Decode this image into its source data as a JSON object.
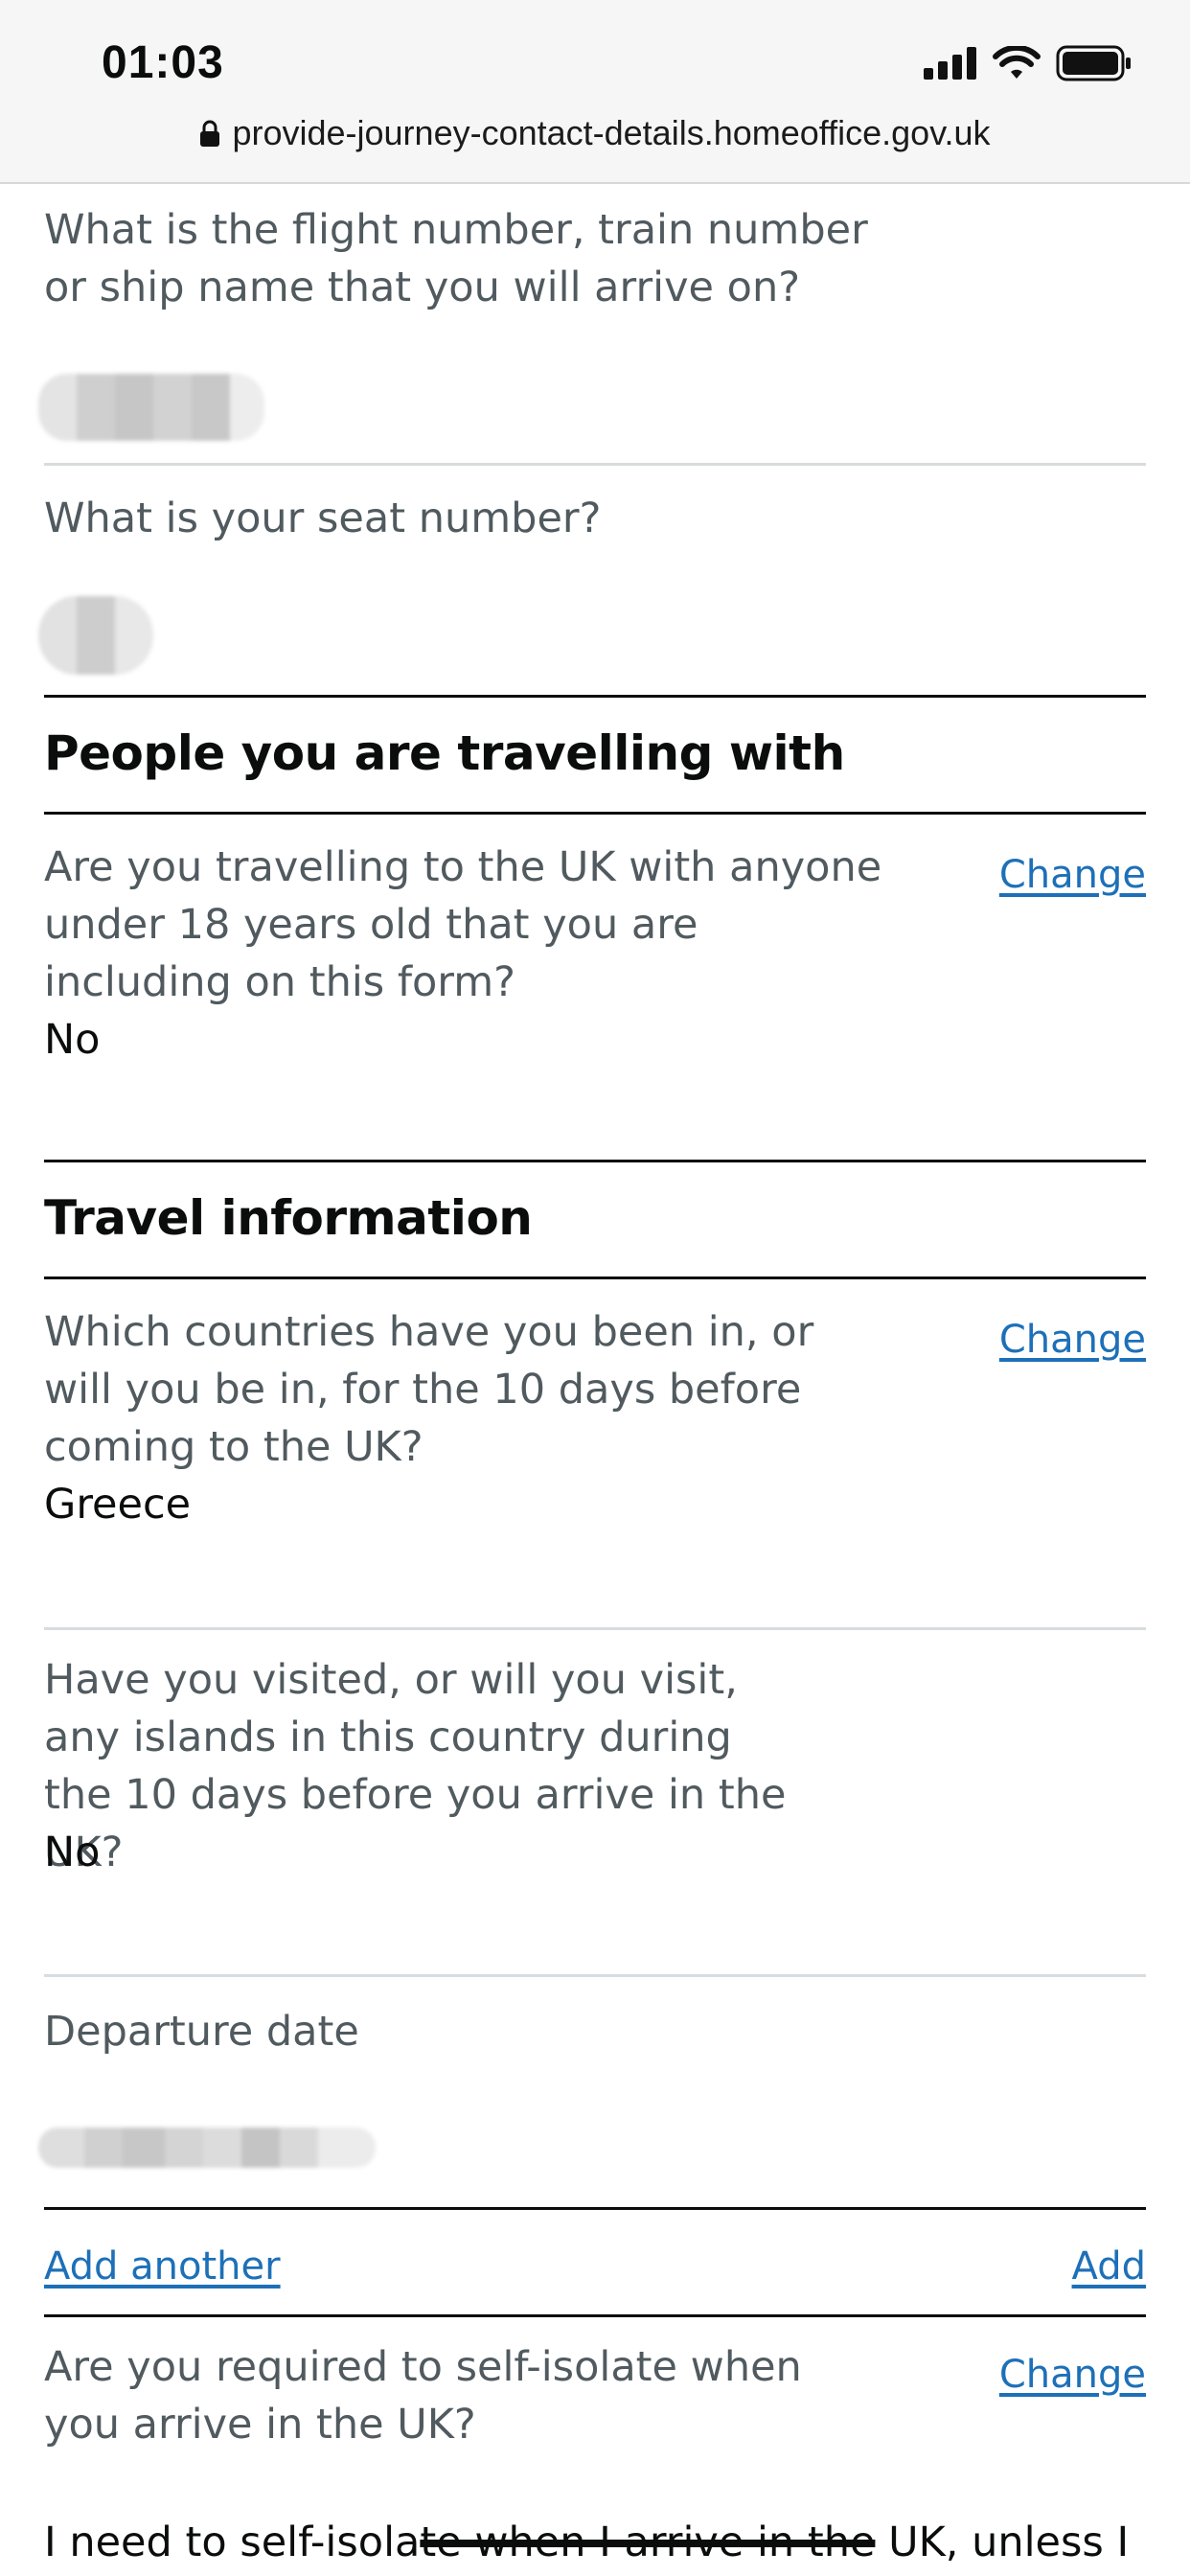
{
  "status_bar": {
    "time": "01:03",
    "icons": [
      "signal-icon",
      "wifi-icon",
      "battery-icon"
    ]
  },
  "browser": {
    "url": "provide-journey-contact-details.homeoffice.gov.uk",
    "lock_icon": "lock-icon"
  },
  "journey": {
    "flight_question": "What is the flight number, train number or ship name that you will arrive on?",
    "seat_question": "What is your seat number?"
  },
  "people_section": {
    "heading": "People you are travelling with",
    "question": "Are you travelling to the UK with anyone under 18 years old that you are including on this form?",
    "answer": "No",
    "change_label": "Change"
  },
  "travel_section": {
    "heading": "Travel information",
    "countries_question": "Which countries have you been in, or will you be in, for the 10 days before coming to the UK?",
    "countries_answer": "Greece",
    "countries_change_label": "Change",
    "islands_question": "Have you visited, or will you visit, any islands in this country during the 10 days before you arrive in the UK?",
    "islands_answer": "No",
    "departure_label": "Departure date",
    "add_another_label": "Add another",
    "add_label": "Add"
  },
  "isolation": {
    "question": "Are you required to self-isolate when you arrive in the UK?",
    "change_label": "Change",
    "answer_start": "I need to self-isola",
    "answer_struck": "te when I arrive in the",
    "answer_end": " UK, unless I"
  },
  "colors": {
    "text": "#0b0c0c",
    "secondary_text": "#505a5f",
    "link": "#1d70b8",
    "divider": "#d9dcde",
    "status_bar_bg": "#f6f6f6"
  }
}
